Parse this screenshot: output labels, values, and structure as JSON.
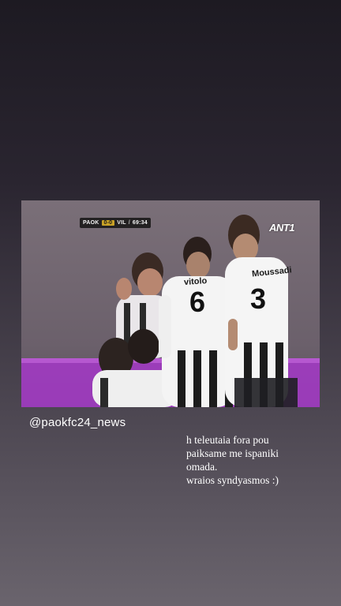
{
  "video": {
    "scorebug": {
      "home": "PAOK",
      "score": "0-0",
      "away": "VIL",
      "separator": "/",
      "clock": "69:34"
    },
    "channel_logo": "ANT1",
    "players": [
      {
        "name": "vitolo",
        "number": "6"
      },
      {
        "name": "Moussadi",
        "number": "3"
      }
    ]
  },
  "mention": {
    "handle": "@paokfc24_news"
  },
  "caption": {
    "lines": [
      "h teleutaia fora pou",
      "paiksame me ispaniki",
      "omada.",
      "wraios syndyasmos :)"
    ]
  }
}
